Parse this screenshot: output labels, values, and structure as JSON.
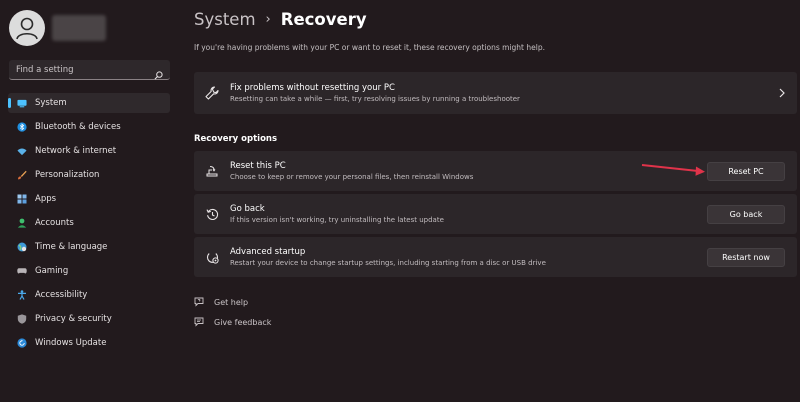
{
  "colors": {
    "accent": "#4cc2ff",
    "background": "#221a1d",
    "card": "#2c2629",
    "annotation_arrow": "#e0334a"
  },
  "sidebar": {
    "search_placeholder": "Find a setting",
    "items": [
      {
        "label": "System",
        "icon": "monitor-icon",
        "active": true
      },
      {
        "label": "Bluetooth & devices",
        "icon": "bluetooth-icon"
      },
      {
        "label": "Network & internet",
        "icon": "wifi-icon"
      },
      {
        "label": "Personalization",
        "icon": "brush-icon"
      },
      {
        "label": "Apps",
        "icon": "apps-icon"
      },
      {
        "label": "Accounts",
        "icon": "person-icon"
      },
      {
        "label": "Time & language",
        "icon": "globe-icon"
      },
      {
        "label": "Gaming",
        "icon": "gamepad-icon"
      },
      {
        "label": "Accessibility",
        "icon": "accessibility-icon"
      },
      {
        "label": "Privacy & security",
        "icon": "shield-icon"
      },
      {
        "label": "Windows Update",
        "icon": "update-icon"
      }
    ]
  },
  "header": {
    "parent": "System",
    "separator": "›",
    "current": "Recovery"
  },
  "intro": "If you're having problems with your PC or want to reset it, these recovery options might help.",
  "fix_card": {
    "title": "Fix problems without resetting your PC",
    "desc": "Resetting can take a while — first, try resolving issues by running a troubleshooter"
  },
  "section_title": "Recovery options",
  "options": [
    {
      "title": "Reset this PC",
      "desc": "Choose to keep or remove your personal files, then reinstall Windows",
      "button": "Reset PC"
    },
    {
      "title": "Go back",
      "desc": "If this version isn't working, try uninstalling the latest update",
      "button": "Go back"
    },
    {
      "title": "Advanced startup",
      "desc": "Restart your device to change startup settings, including starting from a disc or USB drive",
      "button": "Restart now"
    }
  ],
  "links": {
    "help": "Get help",
    "feedback": "Give feedback"
  }
}
